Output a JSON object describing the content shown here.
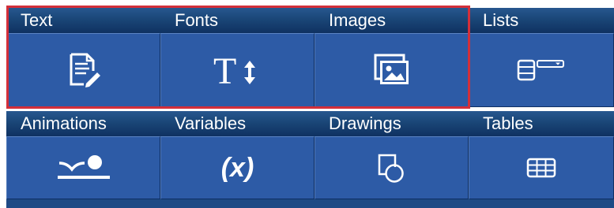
{
  "colors": {
    "header_gradient_top": "#27578f",
    "header_gradient_bottom": "#0f3161",
    "button_fill": "#2d5ba6",
    "selection_border": "#d32f3a",
    "icon_color": "#ffffff"
  },
  "toolbox": {
    "row1": [
      {
        "label": "Text",
        "icon": "document-edit-icon"
      },
      {
        "label": "Fonts",
        "icon": "text-size-icon"
      },
      {
        "label": "Images",
        "icon": "image-gallery-icon"
      },
      {
        "label": "Lists",
        "icon": "list-dropdown-icon"
      }
    ],
    "row2": [
      {
        "label": "Animations",
        "icon": "animation-path-icon"
      },
      {
        "label": "Variables",
        "icon": "variable-x-icon",
        "glyph": "(x)"
      },
      {
        "label": "Drawings",
        "icon": "shapes-icon"
      },
      {
        "label": "Tables",
        "icon": "table-grid-icon"
      }
    ]
  }
}
